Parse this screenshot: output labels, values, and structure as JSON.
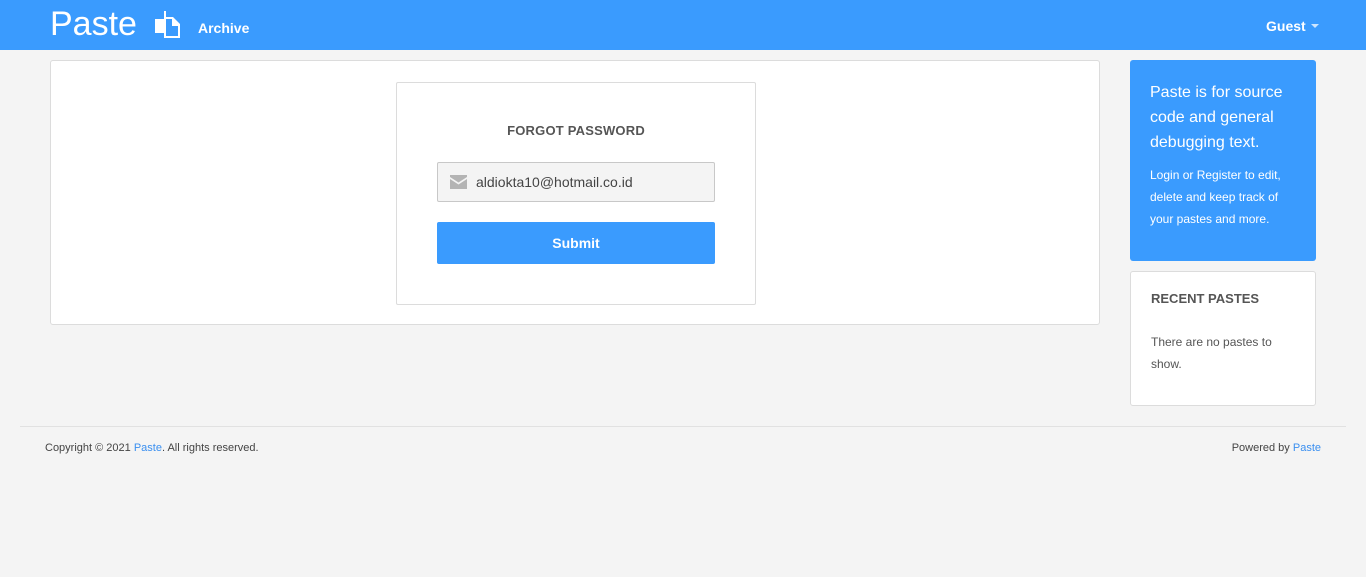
{
  "navbar": {
    "brand": "Paste",
    "brand_icon": "paste-document-icon",
    "archive_label": "Archive",
    "user_label": "Guest",
    "background_color": "#3a9bfe"
  },
  "forgot_password": {
    "title": "FORGOT PASSWORD",
    "email_icon": "envelope-icon",
    "email_value": "aldiokta10@hotmail.co.id",
    "submit_label": "Submit"
  },
  "sidebar": {
    "info_headline": "Paste is for source code and general debugging text.",
    "info_text": "Login or Register to edit, delete and keep track of your pastes and more.",
    "recent_title": "RECENT PASTES",
    "recent_empty": "There are no pastes to show."
  },
  "footer": {
    "copyright_prefix": "Copyright © 2021 ",
    "copyright_link": "Paste",
    "copyright_suffix": ". All rights reserved.",
    "powered_prefix": "Powered by ",
    "powered_link": "Paste",
    "link_color": "#3a8ff0"
  }
}
